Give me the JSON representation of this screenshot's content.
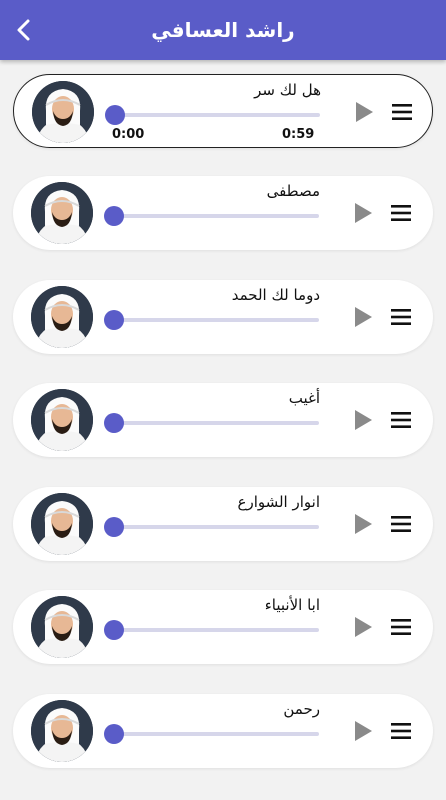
{
  "header": {
    "title": "راشد العسافي",
    "back_icon": "chevron-left-icon"
  },
  "colors": {
    "primary": "#5a5cc8",
    "track": "#d6d6ea",
    "background": "#f2f2f2"
  },
  "tracks": [
    {
      "title": "هل لك سر",
      "progress": 0,
      "elapsed": "0:00",
      "duration": "0:59",
      "active": true
    },
    {
      "title": "مصطفى",
      "progress": 0,
      "active": false
    },
    {
      "title": "دوما لك الحمد",
      "progress": 0,
      "active": false
    },
    {
      "title": "أغيب",
      "progress": 0,
      "active": false
    },
    {
      "title": "انوار الشوارع",
      "progress": 0,
      "active": false
    },
    {
      "title": "ابا الأنبياء",
      "progress": 0,
      "active": false
    },
    {
      "title": "رحمن",
      "progress": 0,
      "active": false
    }
  ]
}
